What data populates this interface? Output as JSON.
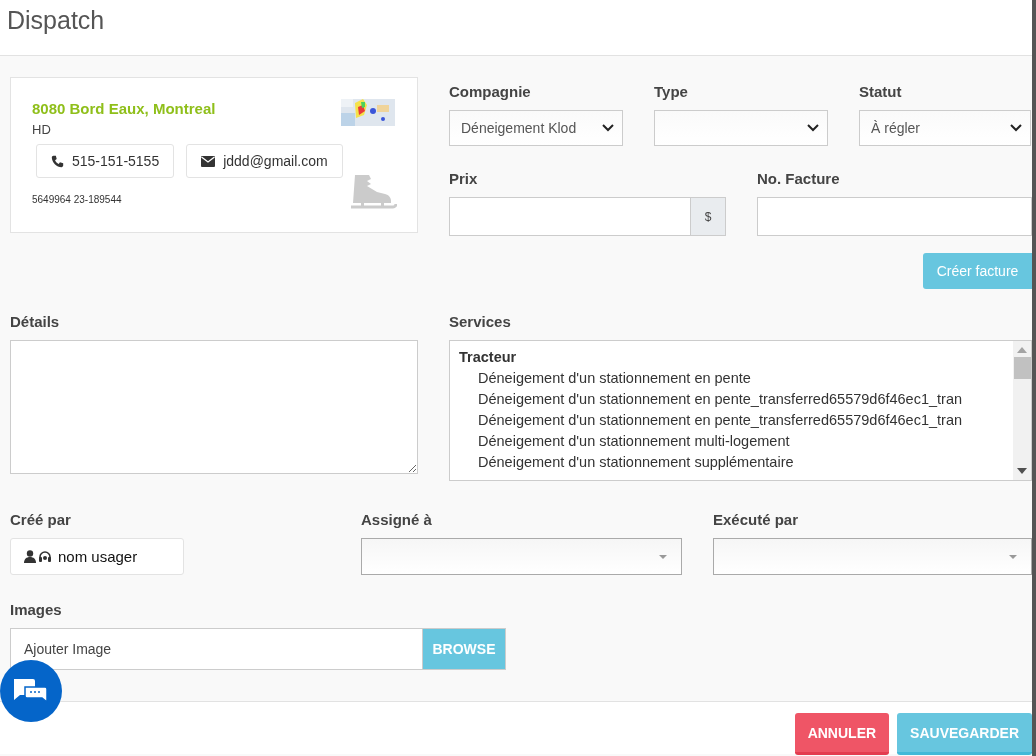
{
  "dialog": {
    "title": "Dispatch"
  },
  "address_card": {
    "address": "8080 Bord Eaux, Montreal",
    "code": "HD",
    "phone": "515-151-5155",
    "email": "jddd@gmail.com",
    "reference": "5649964 23-189544"
  },
  "selects": [
    {
      "label": "Compagnie",
      "value": "Déneigement Klod"
    },
    {
      "label": "Type"
    },
    {
      "label": "Statut",
      "value": "À régler"
    }
  ],
  "price": {
    "label": "Prix",
    "addon": "$"
  },
  "invoice": {
    "label": "No. Facture",
    "button": "Créer facture"
  },
  "details": {
    "label": "Détails"
  },
  "services": {
    "label": "Services",
    "groups": [
      {
        "name": "Tracteur",
        "items": [
          "Déneigement d'un stationnement en pente",
          "Déneigement d'un stationnement en pente_transferred65579d6f46ec1_tran",
          "Déneigement d'un stationnement en pente_transferred65579d6f46ec1_tran",
          "Déneigement d'un stationnement multi-logement",
          "Déneigement d'un stationnement supplémentaire"
        ]
      }
    ]
  },
  "people": [
    {
      "kind": "user",
      "label": "Créé par",
      "value": "nom usager"
    },
    {
      "kind": "dropdown",
      "label": "Assigné à"
    },
    {
      "kind": "dropdown",
      "label": "Exécuté par"
    }
  ],
  "images": {
    "label": "Images",
    "placeholder": "Ajouter Image",
    "button": "BROWSE"
  },
  "buttons": [
    {
      "kind": "cancel",
      "label": "ANNULER"
    },
    {
      "kind": "save",
      "label": "SAUVEGARDER"
    }
  ]
}
